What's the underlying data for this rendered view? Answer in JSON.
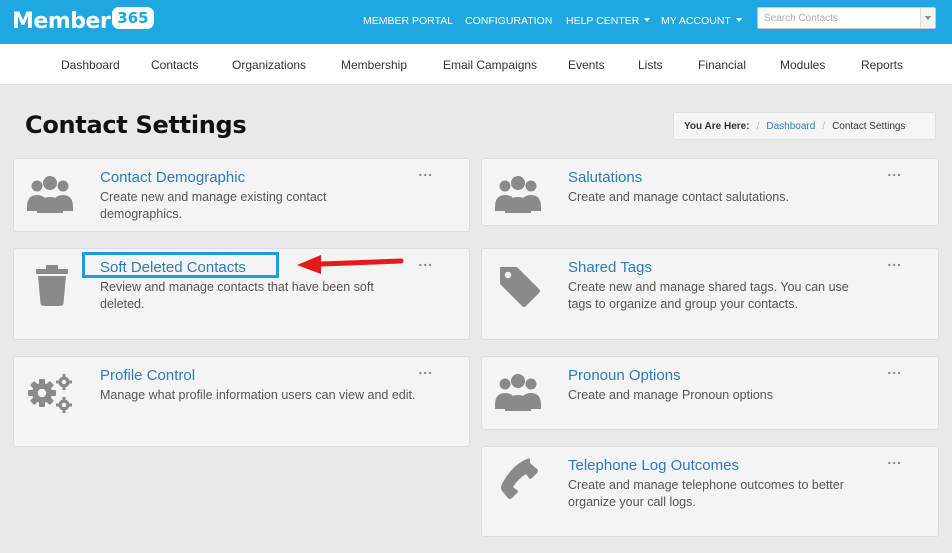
{
  "brand": {
    "word": "Member",
    "badge": "365"
  },
  "topnav": {
    "items": [
      {
        "label": "MEMBER PORTAL",
        "caret": false
      },
      {
        "label": "CONFIGURATION",
        "caret": false
      },
      {
        "label": "HELP CENTER",
        "caret": true
      },
      {
        "label": "MY ACCOUNT",
        "caret": true
      }
    ],
    "search_placeholder": "Search Contacts"
  },
  "subnav": {
    "items": [
      "Dashboard",
      "Contacts",
      "Organizations",
      "Membership",
      "Email Campaigns",
      "Events",
      "Lists",
      "Financial",
      "Modules",
      "Reports"
    ]
  },
  "page": {
    "title": "Contact Settings"
  },
  "breadcrumb": {
    "label": "You Are Here:",
    "link": "Dashboard",
    "current": "Contact Settings"
  },
  "cards": [
    {
      "title": "Contact Demographic",
      "desc": "Create new and manage existing contact demographics.",
      "icon": "users-icon",
      "menu": "..."
    },
    {
      "title": "Salutations",
      "desc": "Create and manage contact salutations.",
      "icon": "users-icon",
      "menu": "..."
    },
    {
      "title": "Soft Deleted Contacts",
      "desc": "Review and manage contacts that have been soft deleted.",
      "icon": "trash-icon",
      "menu": "..."
    },
    {
      "title": "Shared Tags",
      "desc": "Create new and manage shared tags. You can use tags to organize and group your contacts.",
      "icon": "tag-icon",
      "menu": "..."
    },
    {
      "title": "Profile Control",
      "desc": "Manage what profile information users can view and edit.",
      "icon": "gears-icon",
      "menu": "..."
    },
    {
      "title": "Pronoun Options",
      "desc": "Create and manage Pronoun options",
      "icon": "users-icon",
      "menu": "..."
    },
    {
      "title": "Telephone Log Outcomes",
      "desc": "Create and manage telephone outcomes to better organize your call logs.",
      "icon": "phone-icon",
      "menu": "..."
    }
  ],
  "colors": {
    "topbar": "#1ea7e1",
    "link": "#2b7bb9",
    "highlight": "#1e9de0",
    "arrow": "#e31b1b",
    "icon": "#8a8a8a"
  }
}
